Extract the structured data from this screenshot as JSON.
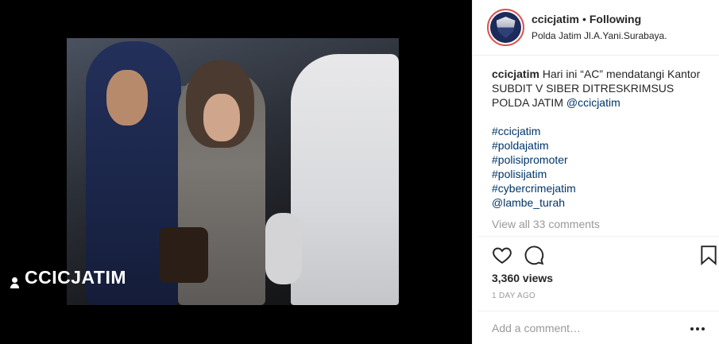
{
  "media": {
    "watermark": "CCICJATIM"
  },
  "header": {
    "username": "ccicjatim",
    "separator": "•",
    "follow_status": "Following",
    "location": "Polda Jatim Jl.A.Yani.Surabaya."
  },
  "caption": {
    "username": "ccicjatim",
    "text": "Hari ini “AC” mendatangi Kantor SUBDIT V SIBER DITRESKRIMSUS POLDA JATIM",
    "mention": "@ccicjatim",
    "hashtags": [
      "#ccicjatim",
      "#poldajatim",
      "#polisipromoter",
      "#polisijatim",
      "#cybercrimejatim",
      "@lambe_turah"
    ],
    "view_comments": "View all 33 comments"
  },
  "stats": {
    "views": "3,360 views",
    "date": "1 DAY AGO"
  },
  "comment": {
    "placeholder": "Add a comment…"
  },
  "icons": {
    "like": "heart-icon",
    "comment": "comment-icon",
    "save": "bookmark-icon",
    "more": "more-options-icon"
  }
}
